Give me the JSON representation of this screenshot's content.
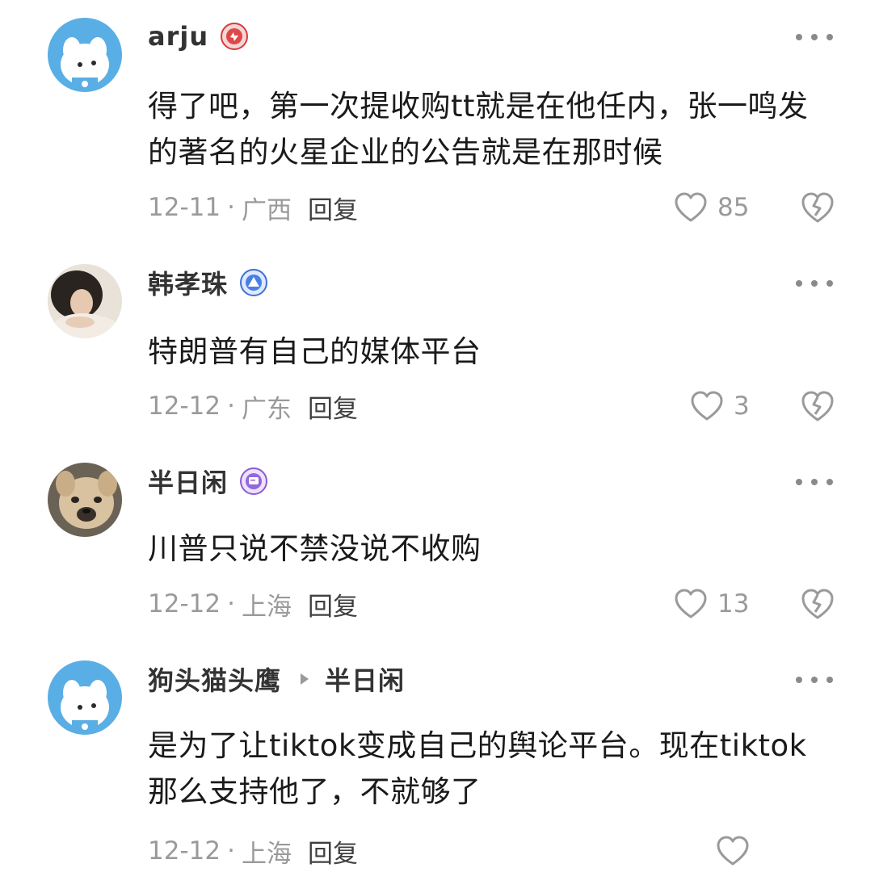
{
  "comments": [
    {
      "author": "arju",
      "badge_icon": "red-badge-icon",
      "text": "得了吧，第一次提收购tt就是在他任内，张一鸣发的著名的火星企业的公告就是在那时候",
      "date": "12-11",
      "location": "广西",
      "reply_label": "回复",
      "likes": "85"
    },
    {
      "author": "韩孝珠",
      "badge_icon": "blue-level-badge-icon",
      "text": "特朗普有自己的媒体平台",
      "date": "12-12",
      "location": "广东",
      "reply_label": "回复",
      "likes": "3"
    },
    {
      "author": "半日闲",
      "badge_icon": "purple-chat-badge-icon",
      "text": "川普只说不禁没说不收购",
      "date": "12-12",
      "location": "上海",
      "reply_label": "回复",
      "likes": "13"
    },
    {
      "author": "狗头猫头鹰",
      "reply_to": "半日闲",
      "text": "是为了让tiktok变成自己的舆论平台。现在tiktok那么支持他了，不就够了",
      "date": "12-12",
      "location": "上海",
      "reply_label": "回复"
    }
  ],
  "separator": "·",
  "colors": {
    "name": "#333333",
    "body_text": "#1a1a1a",
    "meta_text": "#9a9a9a",
    "icon_gray": "#9a9a9a",
    "avatar_blue": "#5aaee6"
  }
}
